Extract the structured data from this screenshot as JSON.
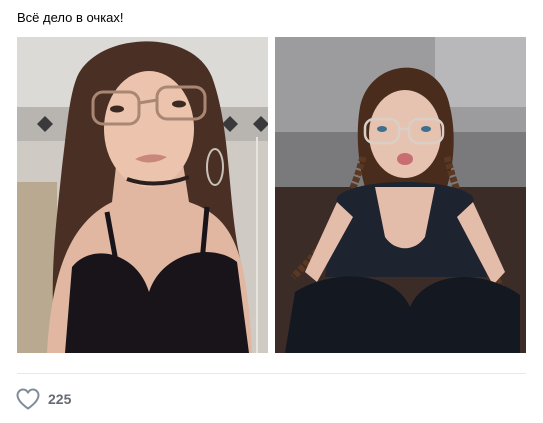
{
  "post": {
    "text": "Всё дело в очках!",
    "photos": [
      {
        "icon": "photo-selfie"
      },
      {
        "icon": "photo-sitting-braids"
      }
    ],
    "likes": {
      "count": "225",
      "icon": "heart-icon",
      "icon_color": "#818c99"
    }
  },
  "colors": {
    "text": "#000000",
    "count_text": "#656b71",
    "divider": "#e7e8ec",
    "background": "#ffffff"
  }
}
